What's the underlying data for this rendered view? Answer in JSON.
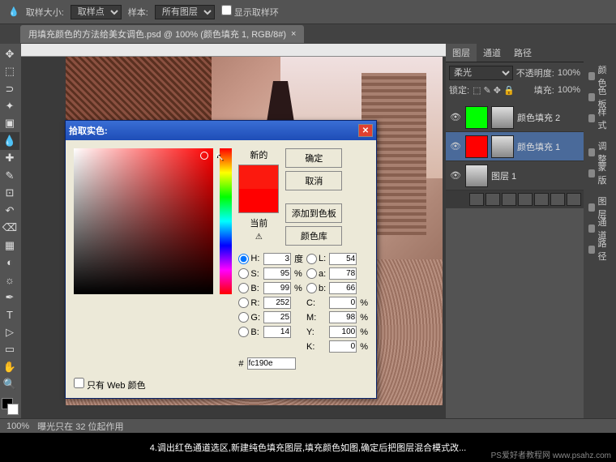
{
  "topbar": {
    "sample_size_label": "取样大小:",
    "sample_size_value": "取样点",
    "sample_label": "样本:",
    "sample_value": "所有图层",
    "show_ring": "显示取样环"
  },
  "doctab": {
    "title": "用填充颜色的方法给美女调色.psd @ 100% (颜色填充 1, RGB/8#)",
    "close": "×"
  },
  "tools": [
    "▭",
    "⬚",
    "✥",
    "✂",
    "✎",
    "✐",
    "⌫",
    "▦",
    "◐",
    "⟋",
    "✍",
    "✎",
    "⊡",
    "▤",
    "⬛",
    "T",
    "▷",
    "⬡",
    "✋",
    "🔍",
    "⊕"
  ],
  "dialog": {
    "title": "拾取实色:",
    "new_label": "新的",
    "current_label": "当前",
    "ok": "确定",
    "cancel": "取消",
    "add_swatch": "添加到色板",
    "color_lib": "颜色库",
    "web_only": "只有 Web 颜色",
    "hex_label": "#",
    "hex_value": "fc190e",
    "modes": {
      "H": {
        "label": "H:",
        "value": "3",
        "unit": "度"
      },
      "S": {
        "label": "S:",
        "value": "95",
        "unit": "%"
      },
      "Bv": {
        "label": "B:",
        "value": "99",
        "unit": "%"
      },
      "R": {
        "label": "R:",
        "value": "252",
        "unit": ""
      },
      "G": {
        "label": "G:",
        "value": "25",
        "unit": ""
      },
      "Bb": {
        "label": "B:",
        "value": "14",
        "unit": ""
      },
      "L": {
        "label": "L:",
        "value": "54",
        "unit": ""
      },
      "a": {
        "label": "a:",
        "value": "78",
        "unit": ""
      },
      "b": {
        "label": "b:",
        "value": "66",
        "unit": ""
      },
      "C": {
        "label": "C:",
        "value": "0",
        "unit": "%"
      },
      "M": {
        "label": "M:",
        "value": "98",
        "unit": "%"
      },
      "Y": {
        "label": "Y:",
        "value": "100",
        "unit": "%"
      },
      "K": {
        "label": "K:",
        "value": "0",
        "unit": "%"
      }
    }
  },
  "rpanels": {
    "icons": [
      "颜色",
      "色板",
      "样式",
      "调整",
      "蒙版",
      "图层",
      "通道",
      "路径"
    ],
    "layers_panel": {
      "tabs": [
        "图层",
        "通道",
        "路径"
      ],
      "blend_mode": "柔光",
      "opacity_label": "不透明度:",
      "opacity": "100%",
      "lock_label": "锁定:",
      "fill_label": "填充:",
      "fill": "100%",
      "layers": [
        {
          "name": "颜色填充 2"
        },
        {
          "name": "颜色填充 1"
        },
        {
          "name": "图层 1"
        }
      ]
    }
  },
  "status": {
    "zoom": "100%",
    "info": "曝光只在 32 位起作用"
  },
  "caption": "4.调出红色通道选区,新建纯色填充图层,填充颜色如图,确定后把图层混合模式改...",
  "watermark": "PS爱好者教程网 www.psahz.com"
}
